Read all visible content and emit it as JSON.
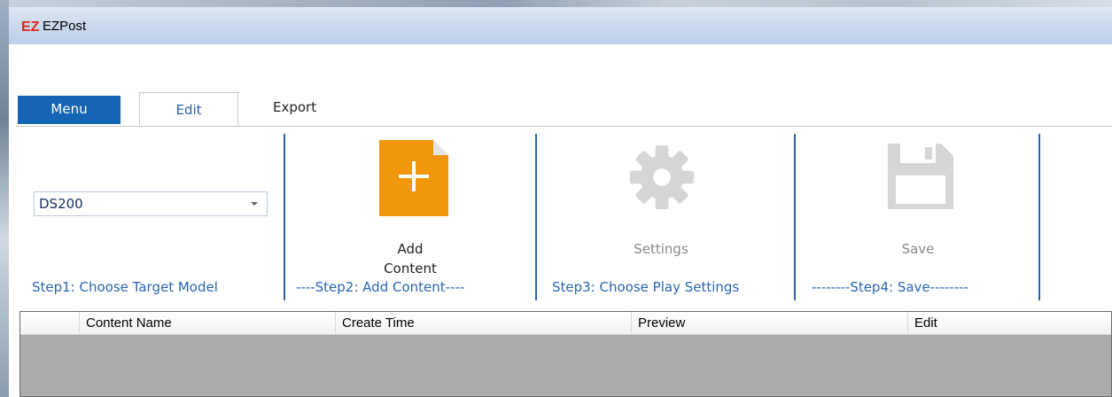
{
  "window": {
    "title": "EZPost",
    "logo_text": "EZ",
    "logo_color": "#e2231a"
  },
  "tabs": {
    "menu": "Menu",
    "edit": "Edit",
    "export": "Export",
    "active": "Edit",
    "menu_color": "#1565b4"
  },
  "ribbon": {
    "step1": {
      "model_value": "DS200",
      "caption": "Step1: Choose Target Model"
    },
    "step2": {
      "button_label_line1": "Add",
      "button_label_line2": "Content",
      "icon": "add-content-icon",
      "icon_color": "#f2960c",
      "caption": "----Step2: Add Content----"
    },
    "step3": {
      "button_label": "Settings",
      "icon": "gear-icon",
      "enabled": false,
      "caption": "Step3: Choose Play Settings"
    },
    "step4": {
      "button_label": "Save",
      "icon": "save-icon",
      "enabled": false,
      "caption": "--------Step4: Save--------"
    },
    "caption_color": "#2a66b1"
  },
  "grid": {
    "columns": [
      "",
      "Content Name",
      "Create Time",
      "Preview",
      "Edit"
    ],
    "rows": []
  }
}
